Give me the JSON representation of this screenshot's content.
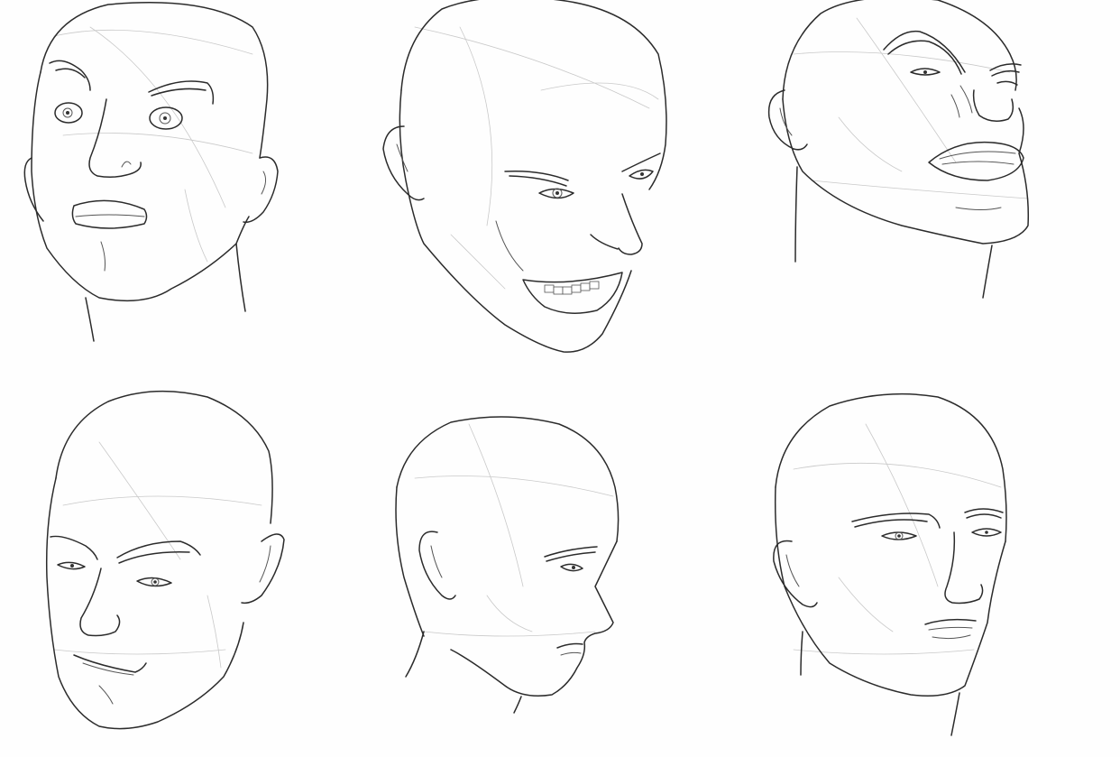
{
  "sheet": {
    "background_color": "#fefefe",
    "line_color": "#2b2b2b",
    "guide_color": "#c9c9c9",
    "heads": [
      {
        "id": "head-1",
        "expression": "shocked",
        "view": "front-three-quarter-up"
      },
      {
        "id": "head-2",
        "expression": "grinning",
        "view": "three-quarter-down"
      },
      {
        "id": "head-3",
        "expression": "snarling",
        "view": "three-quarter-up"
      },
      {
        "id": "head-4",
        "expression": "smirking",
        "view": "three-quarter"
      },
      {
        "id": "head-5",
        "expression": "neutral",
        "view": "profile-three-quarter"
      },
      {
        "id": "head-6",
        "expression": "worried",
        "view": "three-quarter"
      }
    ]
  }
}
